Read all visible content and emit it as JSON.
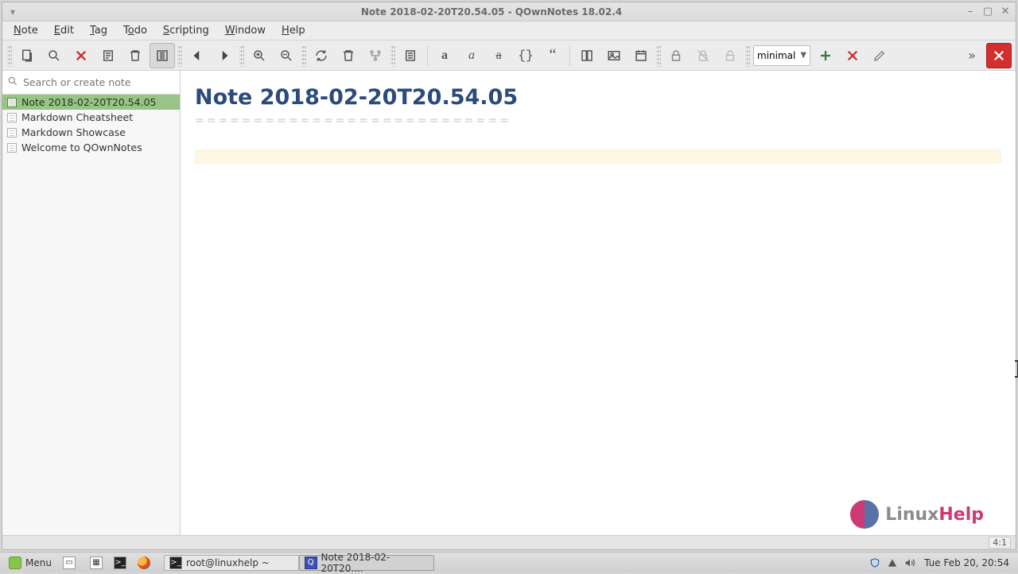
{
  "window": {
    "title": "Note 2018-02-20T20.54.05 - QOwnNotes 18.02.4"
  },
  "menubar": {
    "note": "Note",
    "edit": "Edit",
    "tag": "Tag",
    "todo": "Todo",
    "scripting": "Scripting",
    "window": "Window",
    "help": "Help"
  },
  "toolbar": {
    "workspace_selected": "minimal"
  },
  "sidebar": {
    "search_placeholder": "Search or create note",
    "notes": [
      {
        "title": "Note 2018-02-20T20.54.05",
        "selected": true
      },
      {
        "title": "Markdown Cheatsheet",
        "selected": false
      },
      {
        "title": "Markdown Showcase",
        "selected": false
      },
      {
        "title": "Welcome to QOwnNotes",
        "selected": false
      }
    ]
  },
  "editor": {
    "heading": "Note 2018-02-20T20.54.05",
    "underline": "==========================="
  },
  "statusbar": {
    "linecol": "4:1"
  },
  "watermark": {
    "brand_a": "Linux",
    "brand_b": "Help"
  },
  "taskbar": {
    "menu_label": "Menu",
    "task_terminal": "root@linuxhelp ~",
    "task_app": "Note 2018-02-20T20....",
    "clock": "Tue Feb 20, 20:54"
  }
}
